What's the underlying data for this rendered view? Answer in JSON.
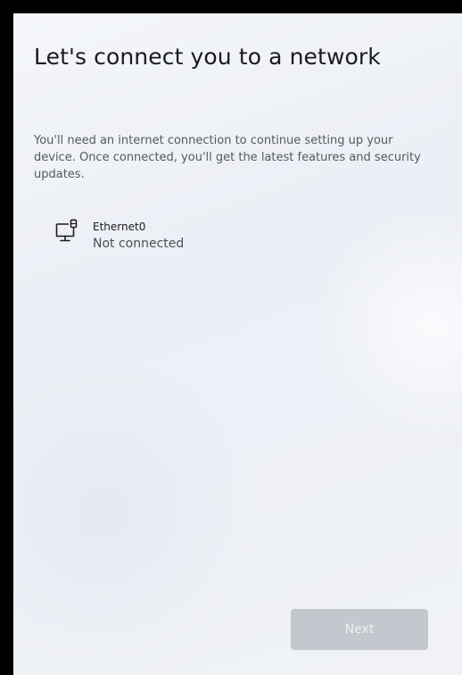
{
  "page": {
    "title": "Let's connect you to a network",
    "description": "You'll need an internet connection to continue setting up your device. Once connected, you'll get the latest features and security updates."
  },
  "networks": [
    {
      "name": "Ethernet0",
      "status": "Not connected",
      "icon": "ethernet-icon"
    }
  ],
  "footer": {
    "next_label": "Next",
    "next_enabled": false
  },
  "colors": {
    "background": "#eef0f5",
    "text_primary": "#1b1b1b",
    "text_secondary": "#555a60",
    "button_disabled_bg": "#c4c8ce",
    "button_disabled_text": "#eef0f3"
  }
}
